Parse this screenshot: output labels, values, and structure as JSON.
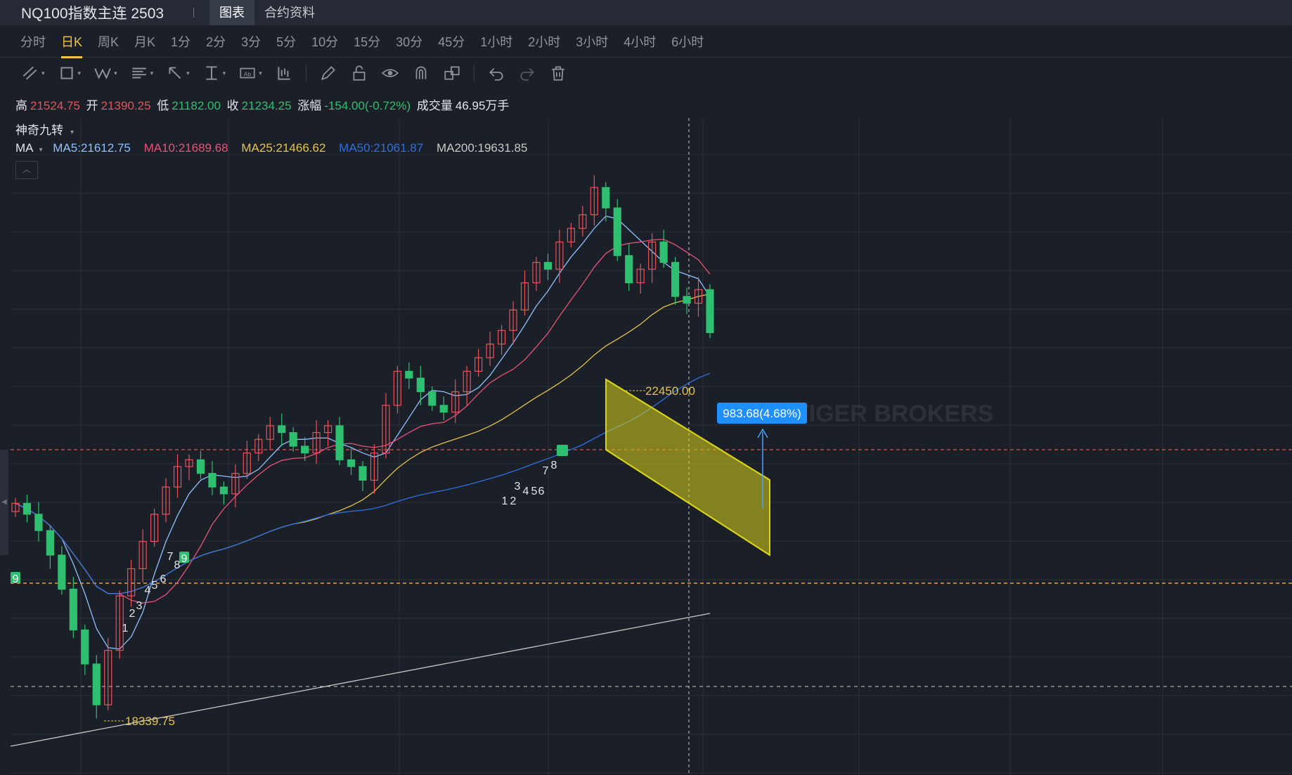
{
  "titlebar": {
    "title": "NQ100指数主连 2503",
    "tabs": [
      "图表",
      "合约资料"
    ]
  },
  "periods": [
    "分时",
    "日K",
    "周K",
    "月K",
    "1分",
    "2分",
    "3分",
    "5分",
    "10分",
    "15分",
    "30分",
    "45分",
    "1小时",
    "2小时",
    "3小时",
    "4小时",
    "6小时"
  ],
  "active_period": "日K",
  "toolbar": {
    "tools": [
      "trendline-icon",
      "rectangle-icon",
      "wave-icon",
      "fib-icon",
      "arrow-icon",
      "measure-icon",
      "text-icon",
      "bar-pattern-icon",
      "pen-icon",
      "lock-icon",
      "eye-icon",
      "magnet-icon",
      "layers-icon",
      "undo-icon",
      "redo-icon",
      "trash-icon"
    ]
  },
  "ohlc": {
    "high_label": "高",
    "high": "21524.75",
    "open_label": "开",
    "open": "21390.25",
    "low_label": "低",
    "low": "21182.00",
    "close_label": "收",
    "close": "21234.25",
    "change_label": "涨幅",
    "change": "-154.00(-0.72%)",
    "volume_label": "成交量",
    "volume": "46.95万手"
  },
  "indicator": {
    "name": "神奇九转"
  },
  "ma": {
    "label": "MA",
    "ma5": "MA5:21612.75",
    "ma10": "MA10:21689.68",
    "ma25": "MA25:21466.62",
    "ma50": "MA50:21061.87",
    "ma200": "MA200:19631.85"
  },
  "colors": {
    "up": "#e8525c",
    "down": "#2fbf71",
    "ma5": "#8fc1ff",
    "ma10": "#e8527a",
    "ma25": "#e6c348",
    "ma50": "#2f6fe0",
    "ma200": "#c8c8c8",
    "channel": "#d8d21c"
  },
  "annotations": {
    "high_marker": "22450.00",
    "low_marker": "18339.75",
    "measure": "983.68(4.68%)",
    "watermark": "TIGER BROKERS",
    "seq_labels": [
      "9",
      "7",
      "8",
      "9",
      "4",
      "5",
      "6",
      "2",
      "3",
      "1",
      "3",
      "4",
      "5",
      "6",
      "1",
      "2",
      "7",
      "8"
    ]
  },
  "chart_data": {
    "type": "candlestick",
    "price_levels": {
      "high_marker": 22450.0,
      "low_marker": 18339.75,
      "last_close": 21234.25
    },
    "closes_approx": [
      19980,
      19900,
      19780,
      19600,
      19350,
      19050,
      18800,
      18500,
      18900,
      19300,
      19500,
      19700,
      19900,
      20100,
      20250,
      20300,
      20200,
      20100,
      20050,
      20200,
      20350,
      20450,
      20550,
      20500,
      20400,
      20350,
      20500,
      20550,
      20300,
      20250,
      20150,
      20350,
      20700,
      20950,
      20900,
      20800,
      20700,
      20650,
      20800,
      20950,
      21050,
      21150,
      21250,
      21400,
      21600,
      21750,
      21700,
      21900,
      22000,
      22100,
      22300,
      22150,
      21800,
      21600,
      21700,
      21900,
      21750,
      21500,
      21450,
      21550,
      21234
    ]
  }
}
